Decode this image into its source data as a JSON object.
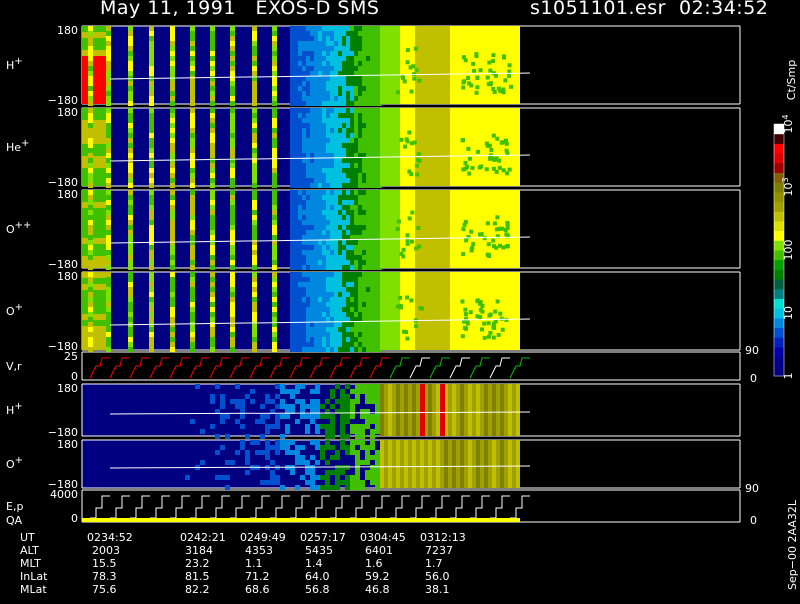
{
  "header": {
    "title": "May 11, 1991   EXOS-D SMS",
    "file": "s1051101.esr  02:34:52"
  },
  "chart_data": {
    "type": "heatmap",
    "panels": [
      {
        "id": "hplus",
        "label": "H",
        "sup": "+",
        "ytop": "180",
        "ybot": "−180",
        "lines": 8
      },
      {
        "id": "heplus",
        "label": "He",
        "sup": "+",
        "ytop": "180",
        "ybot": "−180",
        "lines": 8
      },
      {
        "id": "oplus2",
        "label": "O",
        "sup": "++",
        "ytop": "180",
        "ybot": "−180",
        "lines": 8
      },
      {
        "id": "oplus",
        "label": "O",
        "sup": "+",
        "ytop": "180",
        "ybot": "−180",
        "lines": 8
      },
      {
        "id": "vr",
        "label": "V,r",
        "sup": "",
        "ytop": "25",
        "ybot": "0"
      },
      {
        "id": "hplus2",
        "label": "H",
        "sup": "+",
        "ytop": "180",
        "ybot": "−180"
      },
      {
        "id": "oplus3",
        "label": "O",
        "sup": "+",
        "ytop": "180",
        "ybot": "−180"
      },
      {
        "id": "ep",
        "label": "E,p",
        "sup": "",
        "ytop": "4000",
        "ybot": "0"
      }
    ],
    "qa_label": "QA",
    "right_axis_vr": [
      "90",
      "0"
    ],
    "right_axis_ep": [
      "90",
      "0"
    ],
    "colorbar": {
      "unit": "Ct/Smp",
      "ticks": [
        {
          "label": "1",
          "frac": 0.0
        },
        {
          "label": "10",
          "frac": 0.25
        },
        {
          "label": "100",
          "frac": 0.5
        },
        {
          "label": "10",
          "sup": "3",
          "frac": 0.75
        },
        {
          "label": "10",
          "sup": "4",
          "frac": 1.0
        }
      ],
      "colors": [
        "#000080",
        "#00008f",
        "#0000aa",
        "#0020c0",
        "#0050d0",
        "#0088e0",
        "#00c0e0",
        "#00e0d0",
        "#008080",
        "#006040",
        "#008000",
        "#00a000",
        "#40c000",
        "#80e000",
        "#ffff00",
        "#e0e000",
        "#c0c000",
        "#a0a000",
        "#909000",
        "#808000",
        "#806000",
        "#a00000",
        "#e00000",
        "#ff0000",
        "#400000",
        "#ffffff"
      ]
    },
    "time_axis": {
      "rows": [
        {
          "name": "UT",
          "values": [
            "0234:52",
            "0242:21",
            "0249:49",
            "0257:17",
            "0304:45",
            "0312:13"
          ]
        },
        {
          "name": "ALT",
          "values": [
            "2003",
            "3184",
            "4353",
            "5435",
            "6401",
            "7237"
          ]
        },
        {
          "name": "MLT",
          "values": [
            "15.5",
            "23.2",
            "1.1",
            "1.4",
            "1.6",
            "1.7"
          ]
        },
        {
          "name": "InLat",
          "values": [
            "78.3",
            "81.5",
            "71.2",
            "64.0",
            "59.2",
            "56.0"
          ]
        },
        {
          "name": "MLat",
          "values": [
            "75.6",
            "82.2",
            "68.6",
            "56.8",
            "46.8",
            "38.1"
          ]
        }
      ]
    },
    "side_label": "Sep−00  2AA32L",
    "colors": {
      "background": "#000000",
      "fill": "#000080",
      "yellow": "#ffff00",
      "olive": "#c0c000",
      "green": "#40c000",
      "red": "#ff0000",
      "white": "#ffffff"
    }
  }
}
